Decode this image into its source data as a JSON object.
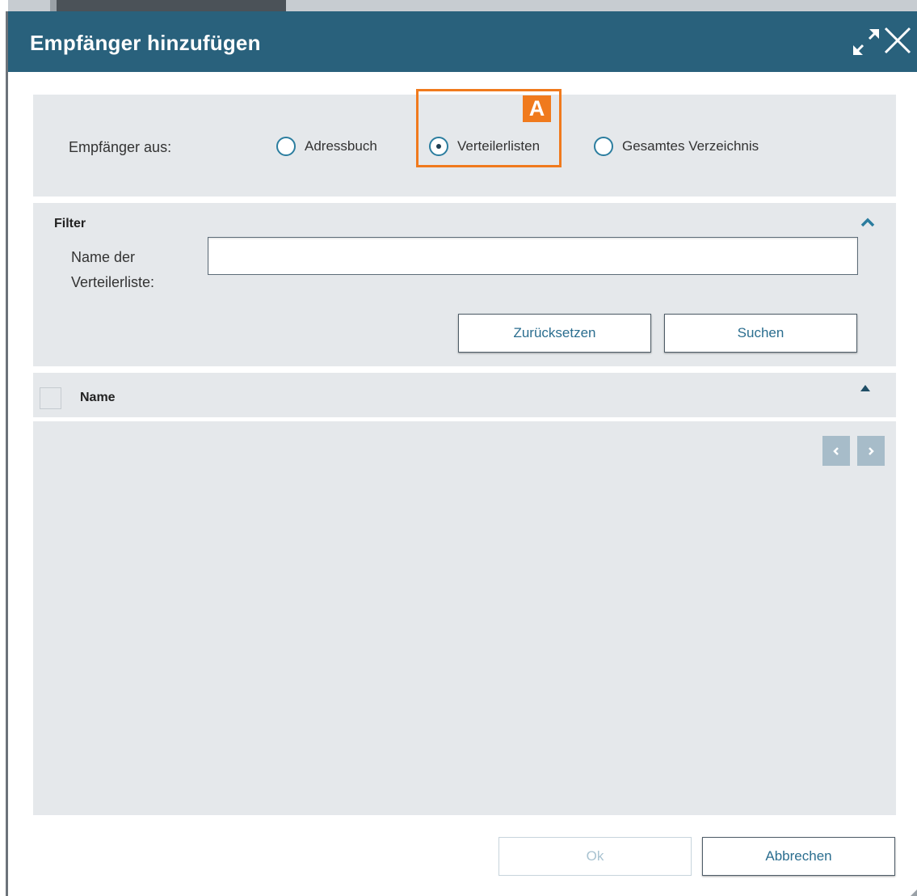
{
  "dialog": {
    "title": "Empfänger hinzufügen",
    "expand_icon": "expand-arrows-icon",
    "close_icon": "close-x-icon"
  },
  "source": {
    "label": "Empfänger aus:",
    "options": [
      {
        "label": "Adressbuch",
        "checked": false
      },
      {
        "label": "Verteilerlisten",
        "checked": true
      },
      {
        "label": "Gesamtes Verzeichnis",
        "checked": false
      }
    ],
    "annotation_badge": "A"
  },
  "filter": {
    "title": "Filter",
    "field_label_line1": "Name der",
    "field_label_line2": "Verteilerliste:",
    "field_value": "",
    "reset_label": "Zurücksetzen",
    "search_label": "Suchen"
  },
  "list": {
    "column_name": "Name",
    "rows": []
  },
  "footer": {
    "ok_label": "Ok",
    "cancel_label": "Abbrechen"
  },
  "colors": {
    "titlebar": "#29617c",
    "panel": "#e5e8eb",
    "accent": "#2b7d9f",
    "annotation": "#f07a1d"
  }
}
